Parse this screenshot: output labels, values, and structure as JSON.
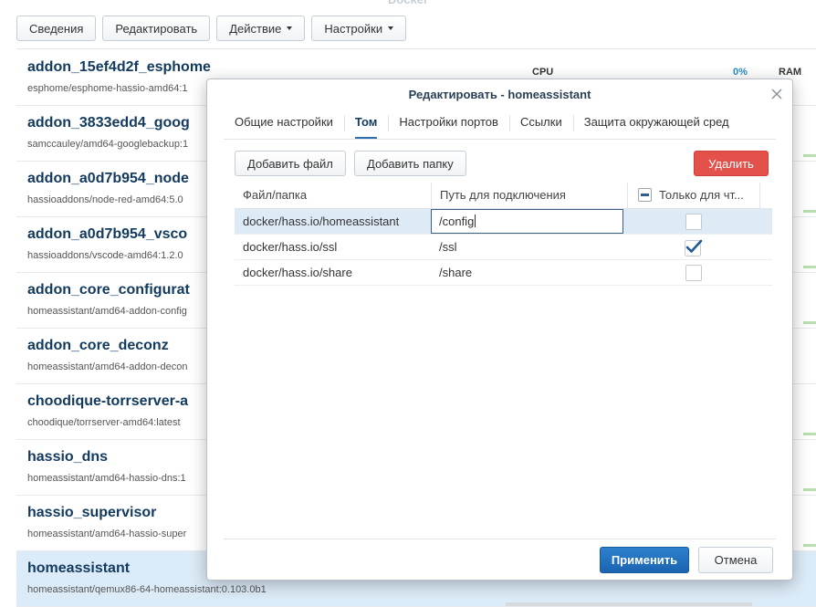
{
  "app": {
    "title": "Docker"
  },
  "toolbar": {
    "details": "Сведения",
    "edit": "Редактировать",
    "action": "Действие",
    "settings": "Настройки"
  },
  "columns": {
    "cpu": "CPU",
    "cpu_value": "0%",
    "ram": "RAM"
  },
  "containers": [
    {
      "name": "addon_15ef4d2f_esphome",
      "image": "esphome/esphome-hassio-amd64:1"
    },
    {
      "name": "addon_3833edd4_goog",
      "image": "samccauley/amd64-googlebackup:1"
    },
    {
      "name": "addon_a0d7b954_node",
      "image": "hassioaddons/node-red-amd64:5.0"
    },
    {
      "name": "addon_a0d7b954_vsco",
      "image": "hassioaddons/vscode-amd64:1.2.0"
    },
    {
      "name": "addon_core_configurat",
      "image": "homeassistant/amd64-addon-config"
    },
    {
      "name": "addon_core_deconz",
      "image": "homeassistant/amd64-addon-decon"
    },
    {
      "name": "choodique-torrserver-a",
      "image": "choodique/torrserver-amd64:latest"
    },
    {
      "name": "hassio_dns",
      "image": "homeassistant/amd64-hassio-dns:1"
    },
    {
      "name": "hassio_supervisor",
      "image": "homeassistant/amd64-hassio-super"
    },
    {
      "name": "homeassistant",
      "image": "homeassistant/qemux86-64-homeassistant:0.103.0b1"
    }
  ],
  "dialog": {
    "title": "Редактировать - homeassistant",
    "tabs": [
      "Общие настройки",
      "Том",
      "Настройки портов",
      "Ссылки",
      "Защита окружающей сред"
    ],
    "active_tab": "Том",
    "add_file": "Добавить файл",
    "add_folder": "Добавить папку",
    "delete": "Удалить",
    "headers": {
      "file": "Файл/папка",
      "mount": "Путь для подключения",
      "readonly": "Только для чт..."
    },
    "rows": [
      {
        "file": "docker/hass.io/homeassistant",
        "mount": "/config",
        "readonly": false,
        "selected": true
      },
      {
        "file": "docker/hass.io/ssl",
        "mount": "/ssl",
        "readonly": true,
        "selected": false
      },
      {
        "file": "docker/hass.io/share",
        "mount": "/share",
        "readonly": false,
        "selected": false
      }
    ],
    "apply": "Применить",
    "cancel": "Отмена"
  },
  "colors": {
    "accent": "#2b70b7",
    "danger": "#e4514a",
    "selected_row": "#dcebf8"
  }
}
